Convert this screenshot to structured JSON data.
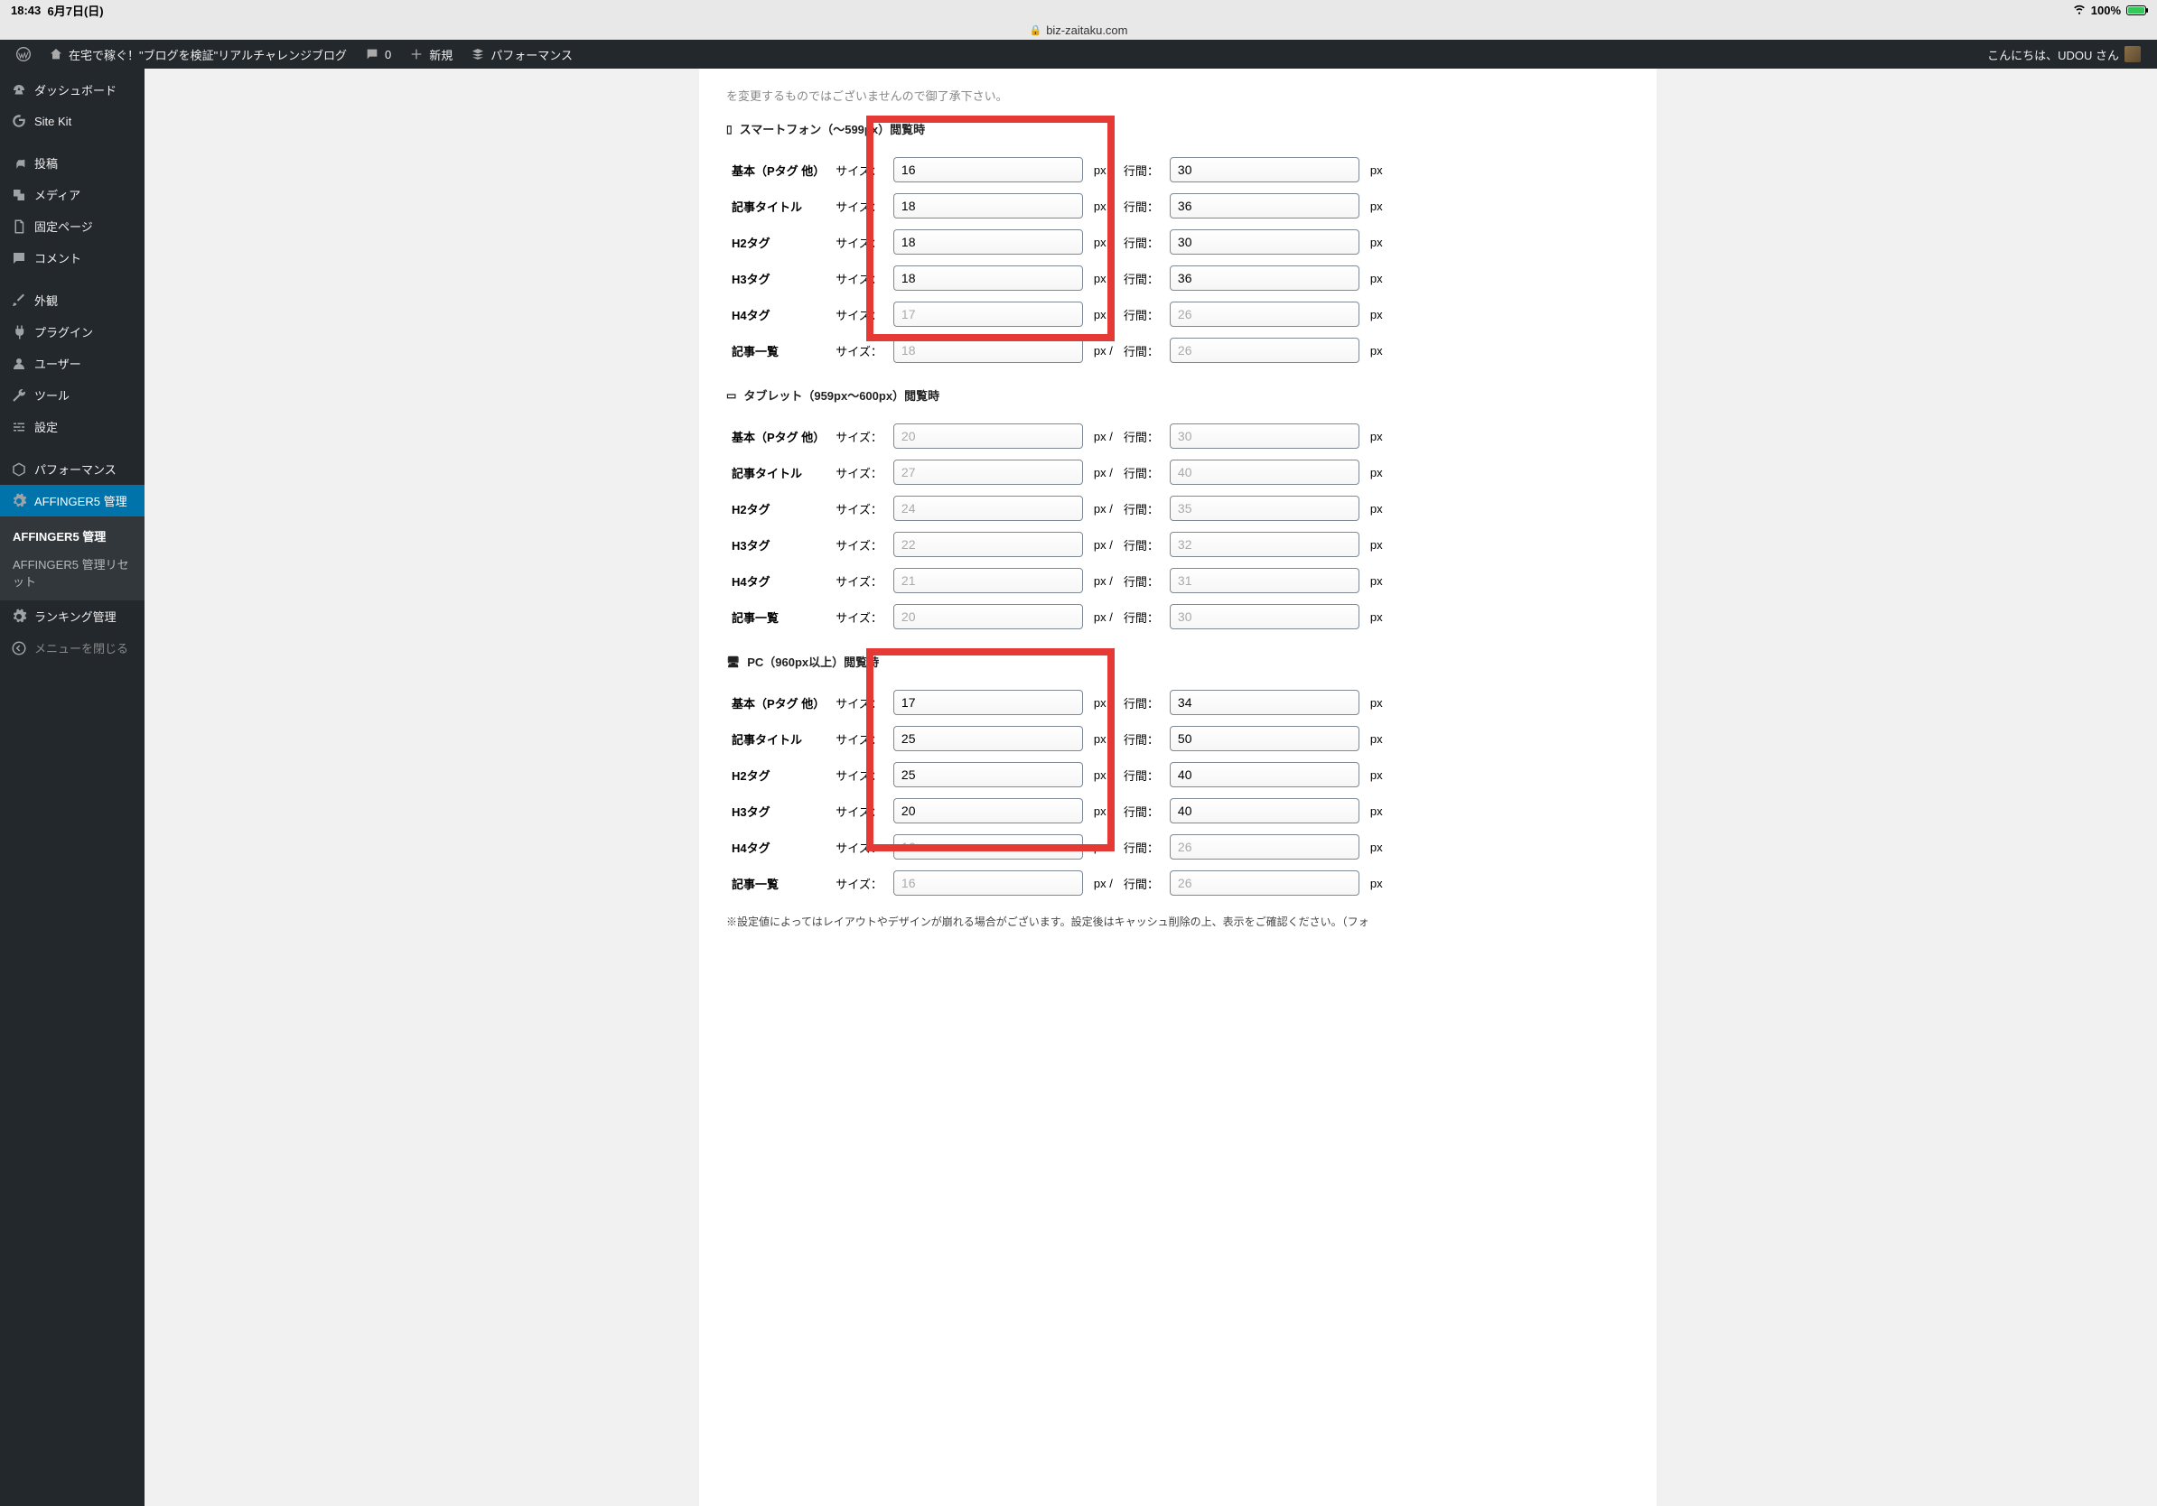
{
  "status": {
    "time": "18:43",
    "date": "6月7日(日)",
    "wifi": "wifi",
    "battery": "100%"
  },
  "url": "biz-zaitaku.com",
  "adminbar": {
    "site_title": "在宅で稼ぐ！\"ブログを検証\"リアルチャレンジブログ",
    "comments": "0",
    "new": "新規",
    "performance": "パフォーマンス",
    "greeting": "こんにちは、UDOU さん"
  },
  "sidebar": {
    "dashboard": "ダッシュボード",
    "sitekit": "Site Kit",
    "posts": "投稿",
    "media": "メディア",
    "pages": "固定ページ",
    "comments": "コメント",
    "appearance": "外観",
    "plugins": "プラグイン",
    "users": "ユーザー",
    "tools": "ツール",
    "settings": "設定",
    "performance": "パフォーマンス",
    "affinger": "AFFINGER5 管理",
    "sub_affinger": "AFFINGER5 管理",
    "sub_reset": "AFFINGER5 管理リセット",
    "ranking": "ランキング管理",
    "collapse": "メニューを閉じる"
  },
  "content": {
    "truncated_line": "を変更するものではございませんので御了承下さい。",
    "size_label": "サイズ：",
    "line_label": "行間：",
    "px": "px",
    "px_slash": "px /",
    "footnote": "※設定値によってはレイアウトやデザインが崩れる場合がございます。設定後はキャッシュ削除の上、表示をご確認ください。（フォ",
    "smartphone": {
      "title": "スマートフォン（〜599px）閲覧時",
      "rows": [
        {
          "label": "基本（Pタグ 他）",
          "size": "16",
          "size_ph": "",
          "line": "30",
          "line_ph": ""
        },
        {
          "label": "記事タイトル",
          "size": "18",
          "size_ph": "",
          "line": "36",
          "line_ph": ""
        },
        {
          "label": "H2タグ",
          "size": "18",
          "size_ph": "",
          "line": "30",
          "line_ph": ""
        },
        {
          "label": "H3タグ",
          "size": "18",
          "size_ph": "",
          "line": "36",
          "line_ph": ""
        },
        {
          "label": "H4タグ",
          "size": "",
          "size_ph": "17",
          "line": "",
          "line_ph": "26"
        },
        {
          "label": "記事一覧",
          "size": "",
          "size_ph": "18",
          "line": "",
          "line_ph": "26"
        }
      ]
    },
    "tablet": {
      "title": "タブレット（959px〜600px）閲覧時",
      "rows": [
        {
          "label": "基本（Pタグ 他）",
          "size": "",
          "size_ph": "20",
          "line": "",
          "line_ph": "30"
        },
        {
          "label": "記事タイトル",
          "size": "",
          "size_ph": "27",
          "line": "",
          "line_ph": "40"
        },
        {
          "label": "H2タグ",
          "size": "",
          "size_ph": "24",
          "line": "",
          "line_ph": "35"
        },
        {
          "label": "H3タグ",
          "size": "",
          "size_ph": "22",
          "line": "",
          "line_ph": "32"
        },
        {
          "label": "H4タグ",
          "size": "",
          "size_ph": "21",
          "line": "",
          "line_ph": "31"
        },
        {
          "label": "記事一覧",
          "size": "",
          "size_ph": "20",
          "line": "",
          "line_ph": "30"
        }
      ]
    },
    "pc": {
      "title": "PC（960px以上）閲覧時",
      "rows": [
        {
          "label": "基本（Pタグ 他）",
          "size": "17",
          "size_ph": "",
          "line": "34",
          "line_ph": ""
        },
        {
          "label": "記事タイトル",
          "size": "25",
          "size_ph": "",
          "line": "50",
          "line_ph": ""
        },
        {
          "label": "H2タグ",
          "size": "25",
          "size_ph": "",
          "line": "40",
          "line_ph": ""
        },
        {
          "label": "H3タグ",
          "size": "20",
          "size_ph": "",
          "line": "40",
          "line_ph": ""
        },
        {
          "label": "H4タグ",
          "size": "",
          "size_ph": "16",
          "line": "",
          "line_ph": "26"
        },
        {
          "label": "記事一覧",
          "size": "",
          "size_ph": "16",
          "line": "",
          "line_ph": "26"
        }
      ]
    }
  }
}
